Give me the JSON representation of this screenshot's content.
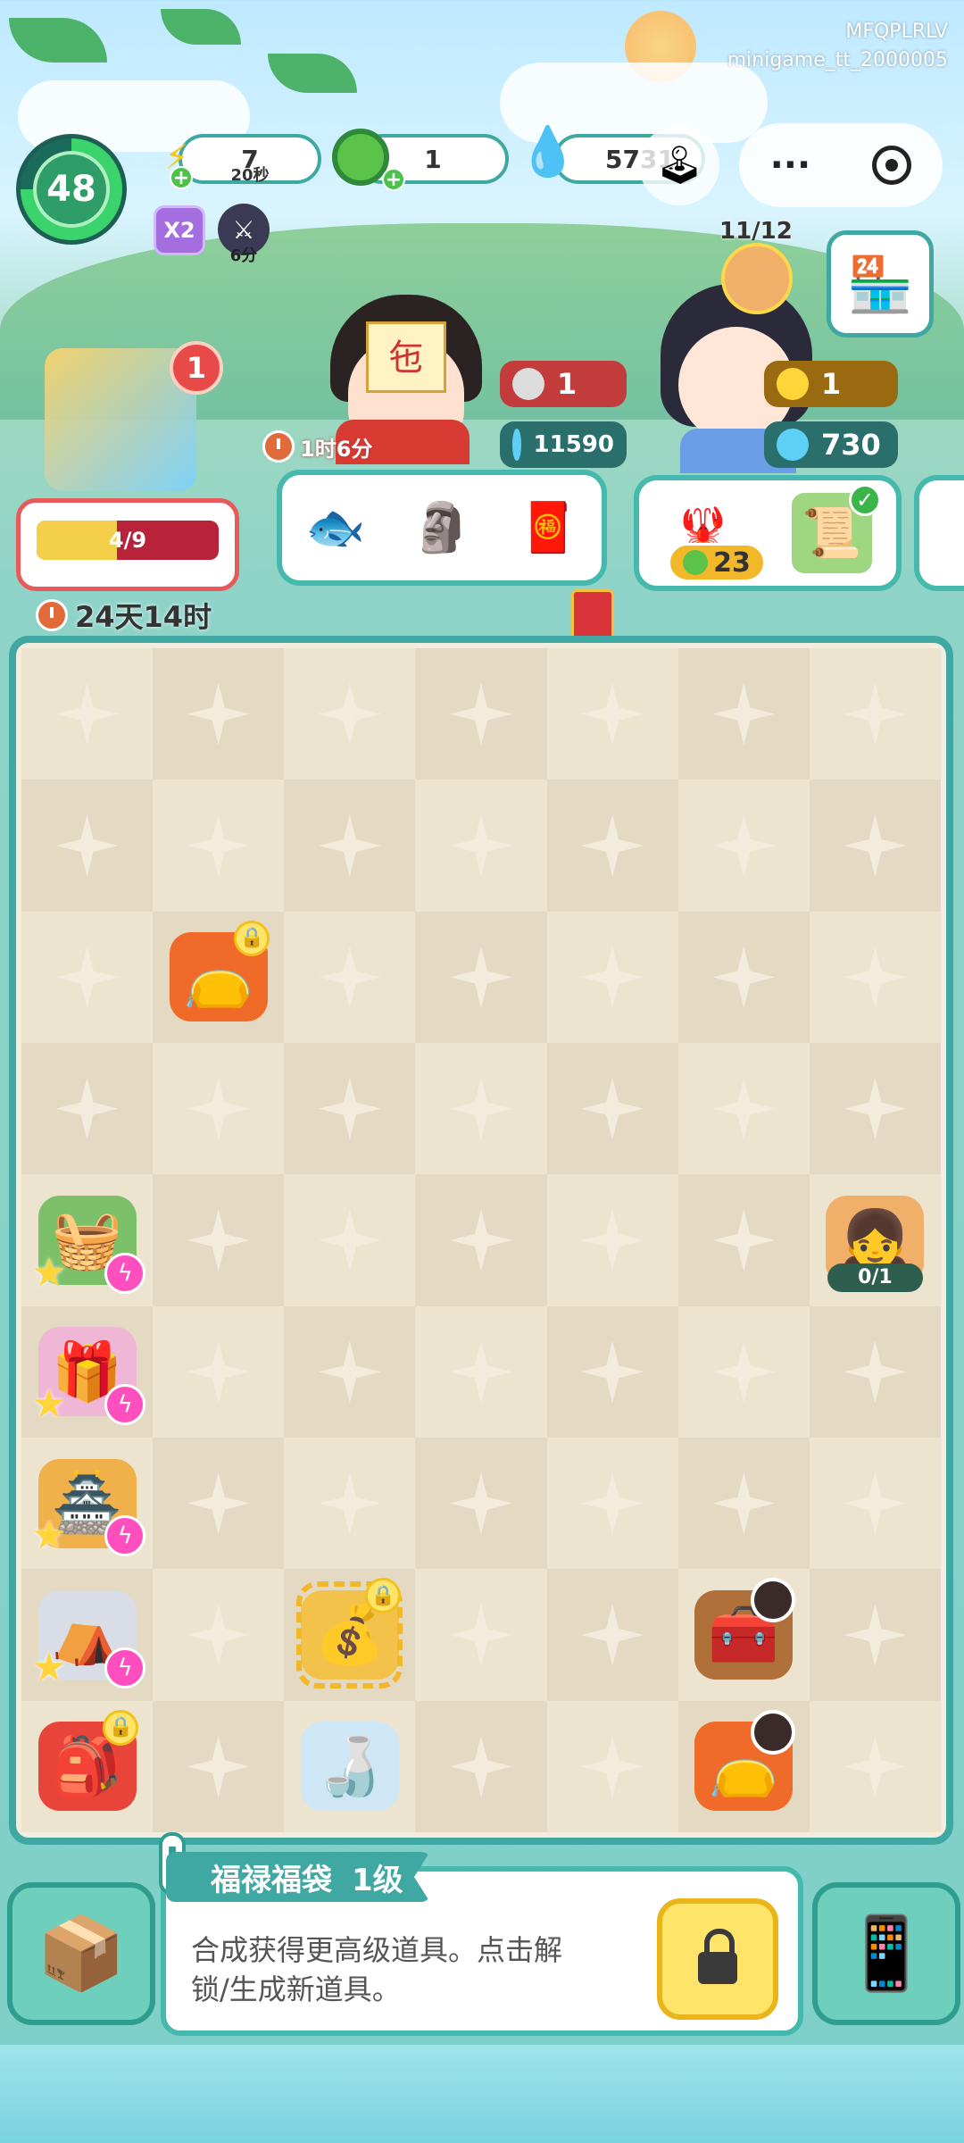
{
  "watermark": {
    "line1": "MFQPLRLV",
    "line2": "minigame_tt_2000005"
  },
  "player": {
    "level": "48"
  },
  "resources": {
    "energy": {
      "value": "7",
      "sub": "20秒",
      "icon": "energy-bolt-icon"
    },
    "coins": {
      "value": "1",
      "icon": "jade-coin-icon"
    },
    "flame": {
      "value": "5731",
      "icon": "blue-flame-icon"
    }
  },
  "capsule": {
    "more": "···",
    "close": "circle-dot-icon"
  },
  "buffs": {
    "x2_label": "X2",
    "buff_time": "6分"
  },
  "playground": {
    "badge": "1",
    "progress_label": "4/9",
    "progress_fraction": 0.44,
    "timer": "24天14时"
  },
  "customers": {
    "c1": {
      "timer": "1时6分",
      "reward_top": "1",
      "reward_bottom": "11590"
    },
    "c2": {
      "reward_top": "1",
      "reward_bottom": "730"
    },
    "c3": {
      "count": "11/12"
    }
  },
  "orders": {
    "o2_badge": "23"
  },
  "board": {
    "rows": 9,
    "cols": 7,
    "items": [
      {
        "row": 2,
        "col": 1,
        "icon": "lucky-bag-icon",
        "color": "#f06a2a",
        "lock": true
      },
      {
        "row": 4,
        "col": 0,
        "icon": "seafood-basket-icon",
        "color": "#7cc06a",
        "star": true,
        "bolt": true
      },
      {
        "row": 4,
        "col": 6,
        "icon": "worker-girl-icon",
        "color": "#f0b06a",
        "count": "0/1"
      },
      {
        "row": 5,
        "col": 0,
        "icon": "gift-box-icon",
        "color": "#f0b6d6",
        "star": true,
        "bolt": true
      },
      {
        "row": 6,
        "col": 0,
        "icon": "temple-icon",
        "color": "#f0b04a",
        "star": true,
        "bolt": true
      },
      {
        "row": 7,
        "col": 0,
        "icon": "tent-icon",
        "color": "#d8dde6",
        "star": true,
        "bolt": true
      },
      {
        "row": 7,
        "col": 2,
        "icon": "gold-bag-icon",
        "color": "#f3c24a",
        "lock": true,
        "selected": true
      },
      {
        "row": 7,
        "col": 5,
        "icon": "treasure-chest-icon",
        "color": "#b0703a",
        "clock": true
      },
      {
        "row": 8,
        "col": 0,
        "icon": "fortune-bag-icon",
        "color": "#e8443a",
        "lock": true
      },
      {
        "row": 8,
        "col": 2,
        "icon": "glass-bottle-icon",
        "color": "#cfe6f6"
      },
      {
        "row": 8,
        "col": 5,
        "icon": "lucky-bag-icon",
        "color": "#f06a2a",
        "clock": true
      }
    ]
  },
  "info": {
    "title": "福禄福袋",
    "level": "1级",
    "desc_line1": "合成获得更高级道具。点击解",
    "desc_line2": "锁/生成新道具。"
  }
}
